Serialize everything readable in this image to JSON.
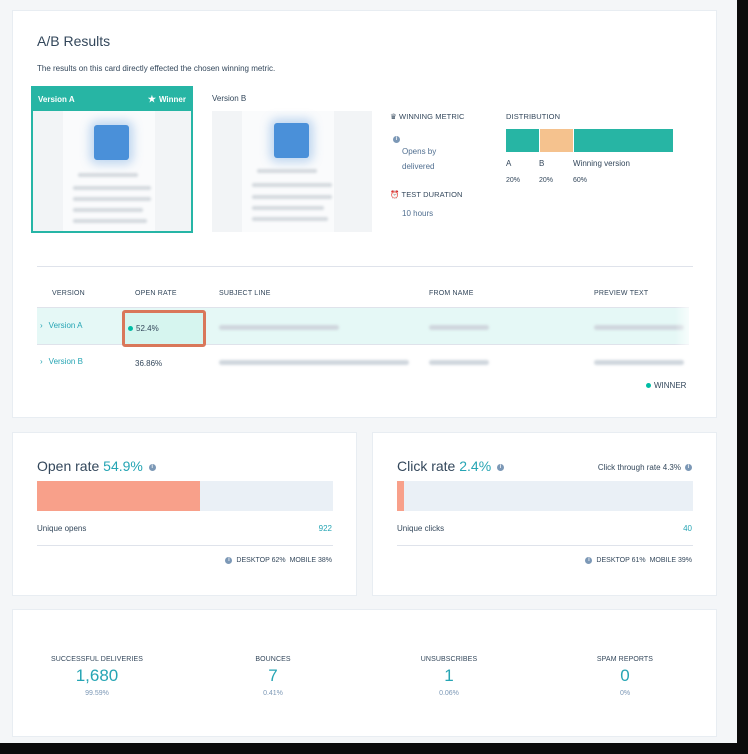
{
  "ab": {
    "title": "A/B Results",
    "description": "The results on this card directly effected the chosen winning metric.",
    "version_a_label": "Version A",
    "winner_label": "Winner",
    "version_b_label": "Version B",
    "winning_metric_label": "WINNING METRIC",
    "winning_metric_value_1": "Opens by",
    "winning_metric_value_2": "delivered",
    "test_duration_label": "TEST DURATION",
    "test_duration_value": "10 hours",
    "distribution": {
      "label": "DISTRIBUTION",
      "segments": [
        {
          "name": "A",
          "pct": "20%",
          "fraction": 0.2,
          "color": "#27b5a4"
        },
        {
          "name": "B",
          "pct": "20%",
          "fraction": 0.2,
          "color": "#f5c28e"
        },
        {
          "name": "Winning version",
          "pct": "60%",
          "fraction": 0.6,
          "color": "#27b5a4"
        }
      ]
    }
  },
  "table": {
    "headers": [
      "VERSION",
      "OPEN RATE",
      "SUBJECT LINE",
      "FROM NAME",
      "PREVIEW TEXT"
    ],
    "rows": [
      {
        "version": "Version A",
        "open_rate": "52.4%",
        "winner": true
      },
      {
        "version": "Version B",
        "open_rate": "36.86%",
        "winner": false
      }
    ],
    "winner_legend": "WINNER"
  },
  "open_rate": {
    "title": "Open rate",
    "value": "54.9%",
    "fraction": 0.549,
    "row_label": "Unique opens",
    "row_value": "922",
    "desktop": "DESKTOP 62%",
    "mobile": "MOBILE 38%"
  },
  "click_rate": {
    "title": "Click rate",
    "value": "2.4%",
    "fraction": 0.024,
    "ctr_label": "Click through rate 4.3%",
    "row_label": "Unique clicks",
    "row_value": "40",
    "desktop": "DESKTOP 61%",
    "mobile": "MOBILE 39%"
  },
  "summary": [
    {
      "label": "SUCCESSFUL DELIVERIES",
      "value": "1,680",
      "pct": "99.59%"
    },
    {
      "label": "BOUNCES",
      "value": "7",
      "pct": "0.41%"
    },
    {
      "label": "UNSUBSCRIBES",
      "value": "1",
      "pct": "0.06%"
    },
    {
      "label": "SPAM REPORTS",
      "value": "0",
      "pct": "0%"
    }
  ],
  "colors": {
    "accent": "#26a5b4",
    "winner_green": "#27b5a4",
    "open_rate_fill": "#f8a08a",
    "highlight_border": "#d9775a"
  }
}
